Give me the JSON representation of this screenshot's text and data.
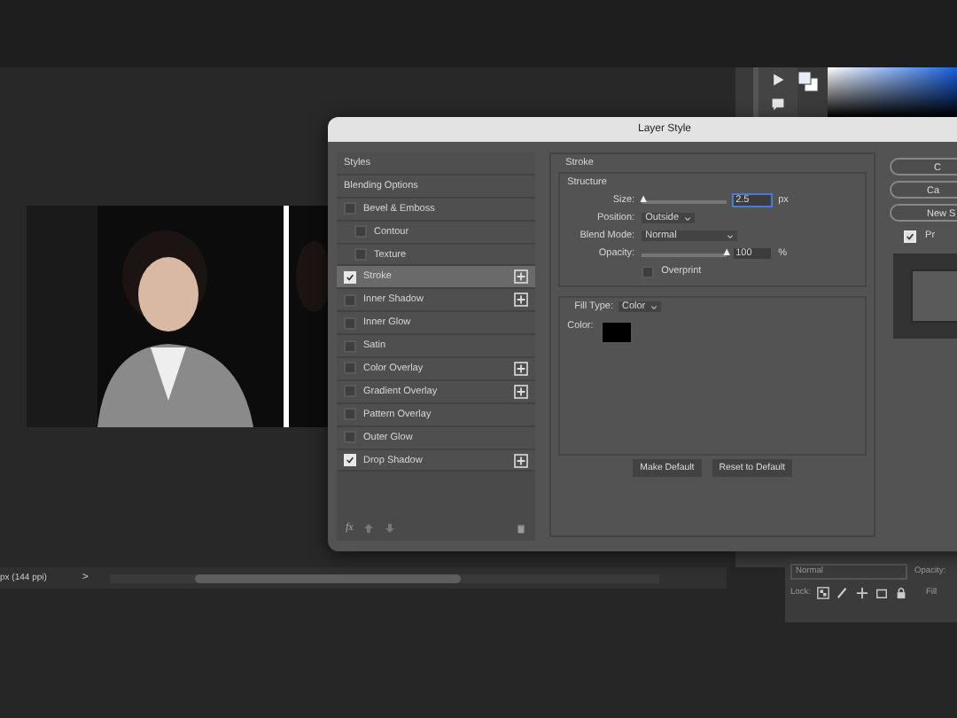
{
  "dialog": {
    "title": "Layer Style",
    "styles": [
      {
        "label": "Styles",
        "kind": "header",
        "selected": false
      },
      {
        "label": "Blending Options",
        "kind": "header",
        "selected": false
      },
      {
        "label": "Bevel & Emboss",
        "kind": "effect",
        "checked": false,
        "add": false,
        "selected": false
      },
      {
        "label": "Contour",
        "kind": "sub",
        "checked": false,
        "add": false,
        "selected": false
      },
      {
        "label": "Texture",
        "kind": "sub",
        "checked": false,
        "add": false,
        "selected": false
      },
      {
        "label": "Stroke",
        "kind": "effect",
        "checked": true,
        "add": true,
        "selected": true
      },
      {
        "label": "Inner Shadow",
        "kind": "effect",
        "checked": false,
        "add": true,
        "selected": false
      },
      {
        "label": "Inner Glow",
        "kind": "effect",
        "checked": false,
        "add": false,
        "selected": false
      },
      {
        "label": "Satin",
        "kind": "effect",
        "checked": false,
        "add": false,
        "selected": false
      },
      {
        "label": "Color Overlay",
        "kind": "effect",
        "checked": false,
        "add": true,
        "selected": false
      },
      {
        "label": "Gradient Overlay",
        "kind": "effect",
        "checked": false,
        "add": true,
        "selected": false
      },
      {
        "label": "Pattern Overlay",
        "kind": "effect",
        "checked": false,
        "add": false,
        "selected": false
      },
      {
        "label": "Outer Glow",
        "kind": "effect",
        "checked": false,
        "add": false,
        "selected": false
      },
      {
        "label": "Drop Shadow",
        "kind": "effect",
        "checked": true,
        "add": true,
        "selected": false
      }
    ],
    "fx_label": "fx",
    "section_title": "Stroke",
    "group_title": "Structure",
    "size": {
      "label": "Size:",
      "level": 0.02,
      "value": "2.5",
      "unit": "px"
    },
    "position": {
      "label": "Position:",
      "value": "Outside"
    },
    "blend_mode": {
      "label": "Blend Mode:",
      "value": "Normal"
    },
    "opacity": {
      "label": "Opacity:",
      "level": 1,
      "value": "100",
      "unit": "%"
    },
    "overprint": {
      "label": "Overprint",
      "checked": false
    },
    "fill_type": {
      "label": "Fill Type:",
      "value": "Color"
    },
    "color": {
      "label": "Color:",
      "color": "#000000"
    },
    "buttons": [
      "Make Default",
      "Reset to Default"
    ],
    "side_buttons": [
      "C",
      "Ca",
      "New S"
    ],
    "preview": {
      "label": "Pr",
      "checked": true
    }
  },
  "status_bar": {
    "text": "px (144 ppi)",
    "arrow": ">"
  },
  "layers_panel": {
    "blend": "Normal",
    "opacity_label": "Opacity:",
    "lock_label": "Lock:",
    "fill_label": "Fill"
  }
}
